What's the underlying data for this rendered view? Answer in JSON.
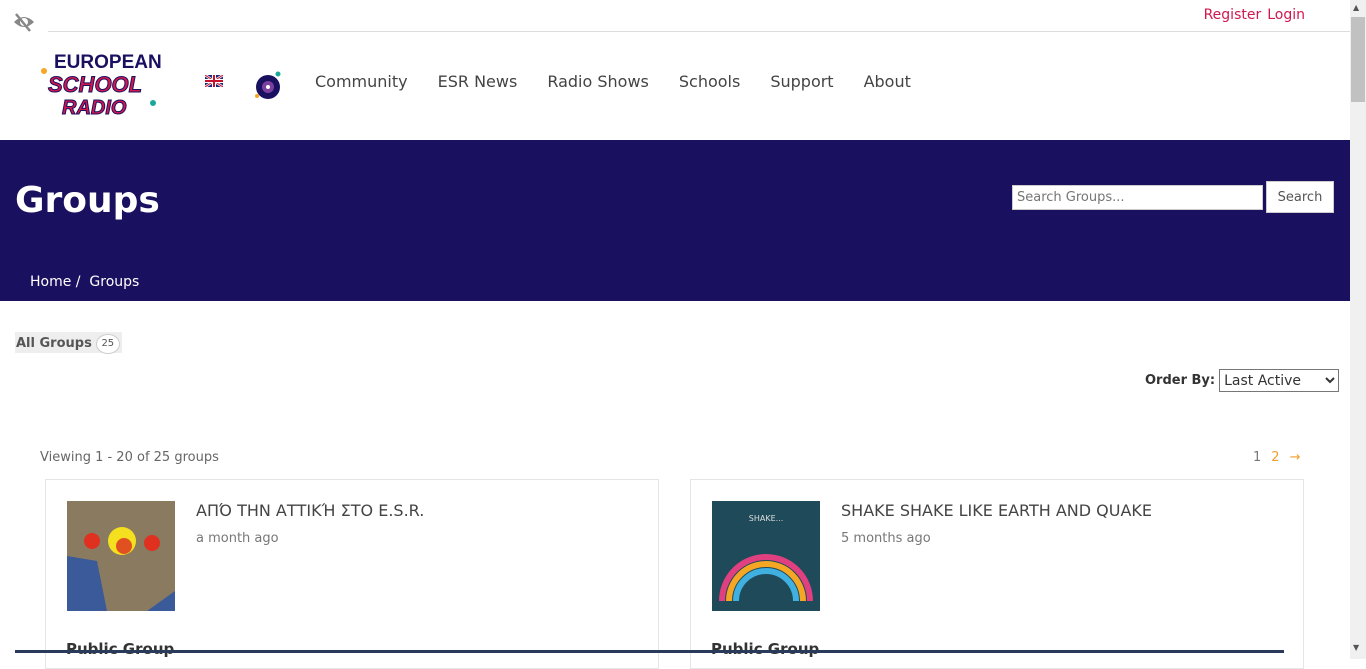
{
  "header": {
    "register": "Register",
    "login": "Login",
    "logo_text": "European School Radio",
    "language": "English",
    "nav": [
      "Community",
      "ESR News",
      "Radio Shows",
      "Schools",
      "Support",
      "About"
    ]
  },
  "hero": {
    "title": "Groups",
    "search_placeholder": "Search Groups...",
    "search_button": "Search",
    "breadcrumb": [
      "Home",
      "Groups"
    ],
    "color": "#1a1060"
  },
  "filters": {
    "all_groups": "All Groups",
    "count": "25",
    "order_label": "Order By:",
    "order_value": "Last Active"
  },
  "listing": {
    "viewing": "Viewing 1 - 20 of 25 groups",
    "pages": [
      "1",
      "2",
      "→"
    ]
  },
  "groups": [
    {
      "title": "ΑΠΌ ΤΗΝ ΑΤΤΙΚΉ ΣΤΟ E.S.R.",
      "time": "a month ago",
      "type": "Public Group"
    },
    {
      "title": "SHAKE SHAKE LIKE EARTH AND QUAKE",
      "time": "5 months ago",
      "type": "Public Group"
    }
  ],
  "colors": {
    "accent": "#d0174e",
    "pagination": "#f0a030"
  }
}
